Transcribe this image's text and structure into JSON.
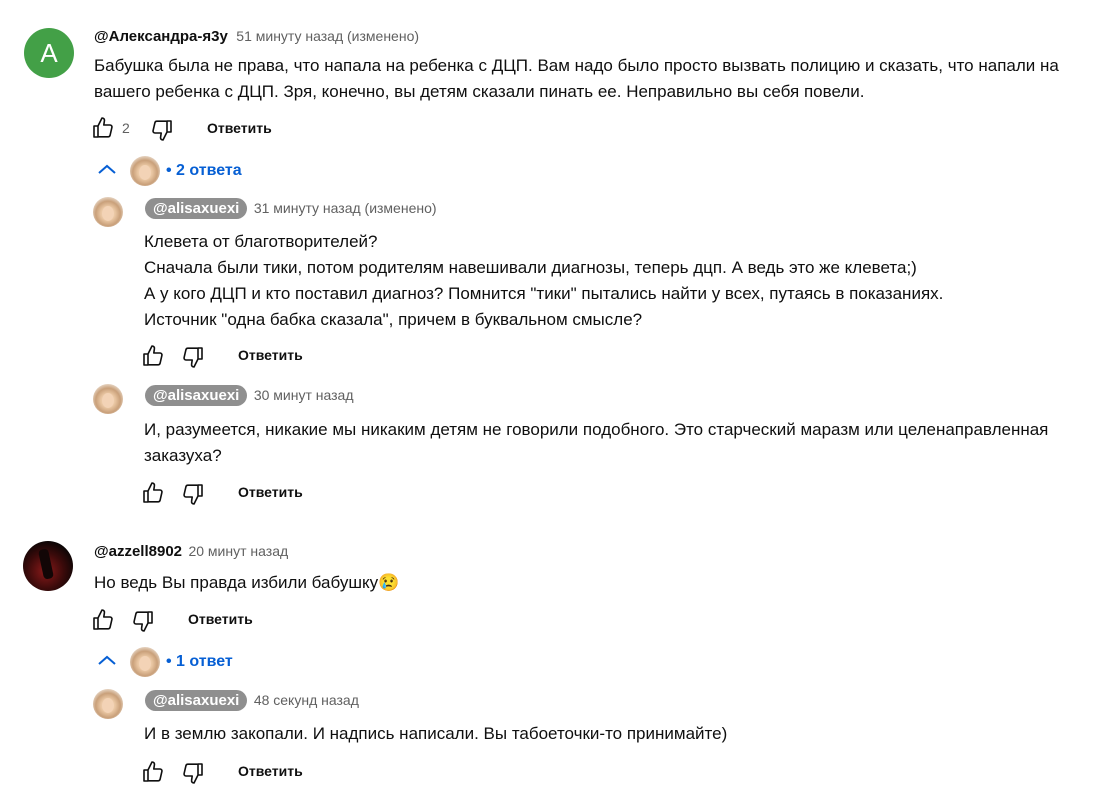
{
  "comments": [
    {
      "avatar_letter": "A",
      "author": "@Александра-я3у",
      "time": "51 минуту назад (изменено)",
      "text": "Бабушка была не права, что напала на ребенка с ДЦП. Вам надо было просто вызвать полицию и сказать, что напали на вашего ребенка с ДЦП. Зря, конечно, вы детям сказали пинать ее. Неправильно вы себя повели.",
      "likes": "2",
      "reply_label": "Ответить",
      "replies_toggle": "2 ответа",
      "replies": [
        {
          "author": "@alisaxuexi",
          "time": "31 минуту назад (изменено)",
          "text": "Клевета от благотворителей?\nСначала были тики, потом родителям навешивали диагнозы, теперь дцп. А ведь это же клевета;)\nА у кого ДЦП и кто поставил диагноз? Помнится \"тики\" пытались найти у всех, путаясь в показаниях.\nИсточник \"одна бабка сказала\", причем в буквальном смысле?",
          "reply_label": "Ответить"
        },
        {
          "author": "@alisaxuexi",
          "time": "30 минут назад",
          "text": "И, разумеется, никакие мы никаким детям не говорили подобного. Это старческий маразм или целенаправленная заказуха?",
          "reply_label": "Ответить"
        }
      ]
    },
    {
      "author": "@azzell8902",
      "time": "20 минут назад",
      "text": "Но ведь Вы правда избили бабушку😢",
      "reply_label": "Ответить",
      "replies_toggle": "1 ответ",
      "replies": [
        {
          "author": "@alisaxuexi",
          "time": "48 секунд назад",
          "text": "И в землю закопали. И надпись написали. Вы табоеточки-то принимайте)",
          "reply_label": "Ответить"
        }
      ]
    }
  ],
  "colors": {
    "link_blue": "#065fd4",
    "avatar_green": "#43a047",
    "pill_gray": "#8f8f8f"
  },
  "icons": [
    "thumbs-up-icon",
    "thumbs-down-icon",
    "chevron-up-icon"
  ]
}
